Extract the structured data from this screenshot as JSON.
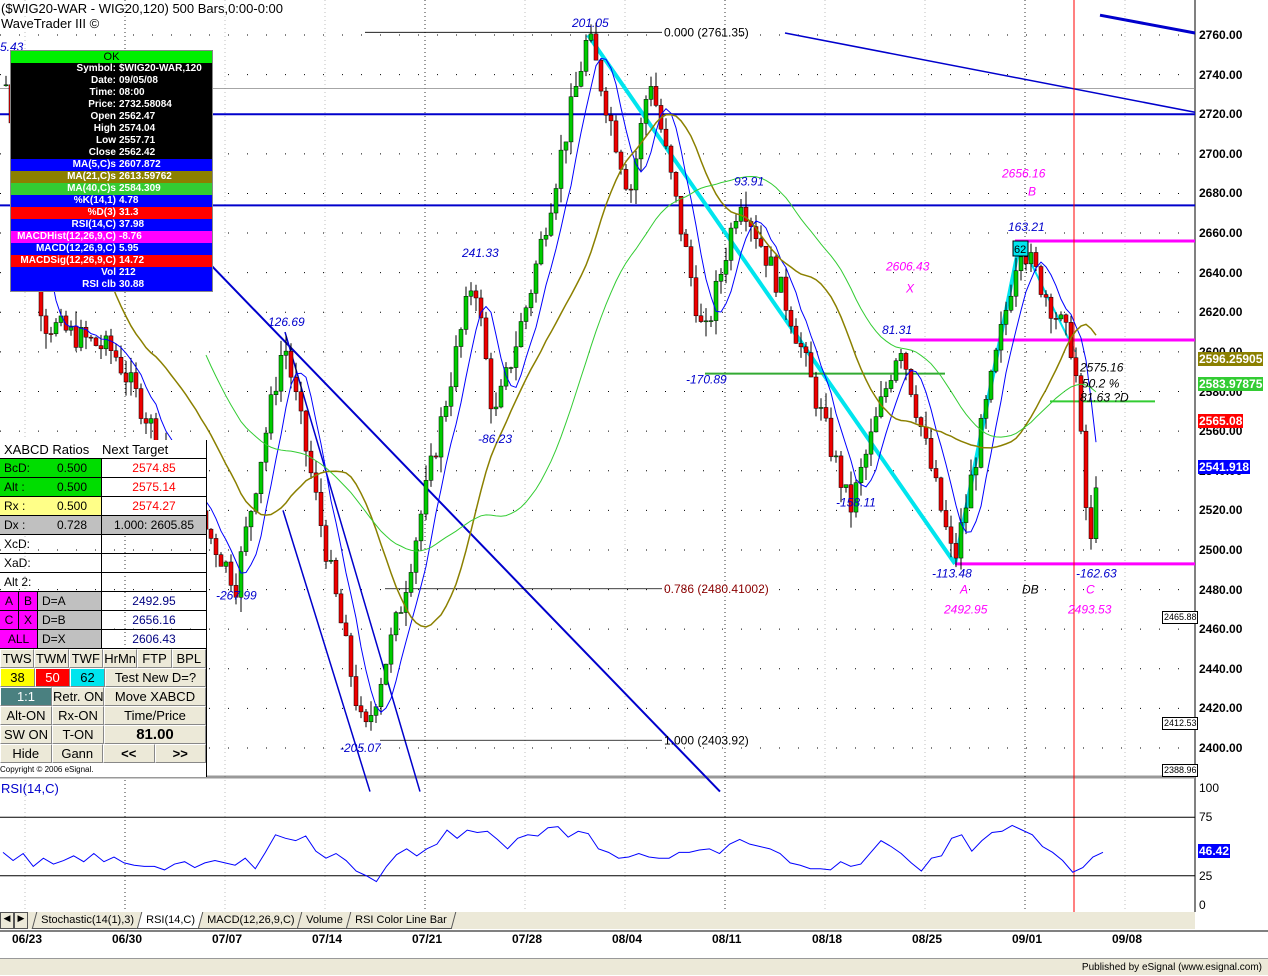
{
  "header": {
    "title": "($WIG20-WAR - WIG20,120) 500 Bars,0:00-0:00",
    "subtitle": "WaveTrader III ©",
    "corner_label": "5.43"
  },
  "info": {
    "ok": "OK",
    "rows": [
      {
        "k": "Symbol:",
        "v": "$WIG20-WAR,120",
        "bg": "#000000"
      },
      {
        "k": "Date:",
        "v": "09/05/08",
        "bg": "#000000"
      },
      {
        "k": "Time:",
        "v": "08:00",
        "bg": "#000000"
      },
      {
        "k": "Price:",
        "v": "2732.58084",
        "bg": "#000000"
      },
      {
        "k": "Open",
        "v": "2562.47",
        "bg": "#000000"
      },
      {
        "k": "High",
        "v": "2574.04",
        "bg": "#000000"
      },
      {
        "k": "Low",
        "v": "2557.71",
        "bg": "#000000"
      },
      {
        "k": "Close",
        "v": "2562.42",
        "bg": "#000000"
      },
      {
        "k": "MA(5,C)s",
        "v": "2607.872",
        "bg": "#0000ff"
      },
      {
        "k": "MA(21,C)s",
        "v": "2613.59762",
        "bg": "#8b8000"
      },
      {
        "k": "MA(40,C)s",
        "v": "2584.309",
        "bg": "#33cc33"
      },
      {
        "k": "%K(14,1)",
        "v": "4.78",
        "bg": "#0000ff"
      },
      {
        "k": "%D(3)",
        "v": "31.3",
        "bg": "#ff0000"
      },
      {
        "k": "RSI(14,C)",
        "v": "37.98",
        "bg": "#0000ff"
      },
      {
        "k": "MACDHist(12,26,9,C)",
        "v": "-8.76",
        "bg": "#ff00ff"
      },
      {
        "k": "MACD(12,26,9,C)",
        "v": "5.95",
        "bg": "#0000ff"
      },
      {
        "k": "MACDSig(12,26,9,C)",
        "v": "14.72",
        "bg": "#ff0000"
      },
      {
        "k": "Vol",
        "v": "212",
        "bg": "#0000ff"
      },
      {
        "k": "RSI clb",
        "v": "30.88",
        "bg": "#0000ff"
      }
    ]
  },
  "xabcd": {
    "header": "XABCD Ratios",
    "header2": "Next Target",
    "ratios": [
      {
        "k": "BcD:",
        "r": "0.500",
        "v": "2574.85",
        "bg": "#00dd00"
      },
      {
        "k": "Alt  :",
        "r": "0.500",
        "v": "2575.14",
        "bg": "#00dd00"
      },
      {
        "k": "Rx   :",
        "r": "0.500",
        "v": "2574.27",
        "bg": "#ffff88"
      },
      {
        "k": "Dx   :",
        "r": "0.728",
        "v": "1.000: 2605.85",
        "bg": "#c0c0c0"
      }
    ],
    "empty": [
      "XcD:",
      "XaD:",
      "Alt 2:"
    ],
    "d_rows": [
      {
        "a": "A",
        "b": "B",
        "k": "D=A",
        "v": "2492.95"
      },
      {
        "a": "C",
        "b": "X",
        "k": "D=B",
        "v": "2656.16"
      },
      {
        "a": "ALL",
        "b": "",
        "k": "D=X",
        "v": "2606.43"
      }
    ],
    "buttons1": [
      "TWS",
      "TWM",
      "TWF",
      "HrMn",
      "FTP",
      "BPL"
    ],
    "fib": [
      "38",
      "50",
      "62"
    ],
    "test": "Test New D=?",
    "b3": [
      "1:1",
      "Retr. ON",
      "Move XABCD"
    ],
    "b4": [
      "Alt-ON",
      "Rx-ON",
      "Time/Price"
    ],
    "b5": [
      "SW ON",
      "T-ON",
      "81.00"
    ],
    "b6": [
      "Hide",
      "Gann",
      "<<",
      ">>"
    ],
    "copyright": "Copyright © 2006 eSignal."
  },
  "chart_data": {
    "type": "candlestick",
    "ylim": [
      2385,
      2770
    ],
    "yticks": [
      "2760.00",
      "2740.00",
      "2720.00",
      "2700.00",
      "2680.00",
      "2660.00",
      "2640.00",
      "2620.00",
      "2600.00",
      "2580.00",
      "2560.00",
      "2540.00",
      "2520.00",
      "2500.00",
      "2480.00",
      "2460.00",
      "2440.00",
      "2420.00",
      "2400.00"
    ],
    "xticks": [
      "06/23",
      "06/30",
      "07/07",
      "07/14",
      "07/21",
      "07/28",
      "08/04",
      "08/11",
      "08/18",
      "08/25",
      "09/01",
      "09/08"
    ],
    "pivots": [
      [
        -1.2,
        2735
      ],
      [
        0.7,
        2615
      ],
      [
        4.2,
        2600
      ],
      [
        7.2,
        2540
      ],
      [
        10.3,
        2483
      ],
      [
        12.7,
        2606
      ],
      [
        16.7,
        2405
      ],
      [
        18.5,
        2470
      ],
      [
        22.2,
        2640
      ],
      [
        23.2,
        2565
      ],
      [
        25,
        2630
      ],
      [
        27.9,
        2760
      ],
      [
        30,
        2680
      ],
      [
        31,
        2740
      ],
      [
        33.7,
        2605
      ],
      [
        35.5,
        2680
      ],
      [
        38,
        2620
      ],
      [
        41,
        2520
      ],
      [
        43.5,
        2606
      ],
      [
        46.2,
        2493
      ],
      [
        49.5,
        2656
      ],
      [
        52.2,
        2600
      ],
      [
        53,
        2495
      ],
      [
        53.5,
        2565
      ]
    ],
    "price_tags": [
      {
        "v": "2596.25905",
        "c": "#8b8000",
        "p": 2596.26
      },
      {
        "v": "2583.97875",
        "c": "#33cc33",
        "p": 2583.98
      },
      {
        "v": "2565.08",
        "c": "#ff0000",
        "p": 2565.08
      },
      {
        "v": "2541.918",
        "c": "#0000ff",
        "p": 2541.92
      }
    ],
    "side_boxes": [
      {
        "v": "2465.88",
        "p": 2465.9
      },
      {
        "v": "2412.53",
        "p": 2412.5
      },
      {
        "v": "2388.96",
        "p": 2389
      }
    ],
    "annotations": [
      {
        "t": "201.05",
        "p": 2764,
        "d": 27.1,
        "c": "#0000cc"
      },
      {
        "t": "241.33",
        "p": 2648,
        "d": 21.6,
        "c": "#0000cc"
      },
      {
        "t": "126.69",
        "p": 2613,
        "d": 11.9,
        "c": "#0000cc"
      },
      {
        "t": "-86.23",
        "p": 2554,
        "d": 22.4,
        "c": "#0000cc"
      },
      {
        "t": "-267.99",
        "p": 2475,
        "d": 9.3,
        "c": "#0000cc"
      },
      {
        "t": "-205.07",
        "p": 2398,
        "d": 15.5,
        "c": "#0000cc"
      },
      {
        "t": "93.91",
        "p": 2684,
        "d": 35.2,
        "c": "#0000cc"
      },
      {
        "t": "-170.89",
        "p": 2584,
        "d": 32.8,
        "c": "#0000cc"
      },
      {
        "t": "-158.11",
        "p": 2522,
        "d": 40.3,
        "c": "#0000cc"
      },
      {
        "t": "81.31",
        "p": 2609,
        "d": 42.6,
        "c": "#0000cc"
      },
      {
        "t": "-113.48",
        "p": 2486,
        "d": 45.1,
        "c": "#0000cc"
      },
      {
        "t": "163.21",
        "p": 2661,
        "d": 48.9,
        "c": "#0000cc"
      },
      {
        "t": "-162.63",
        "p": 2486,
        "d": 52.3,
        "c": "#0000cc"
      },
      {
        "t": "2656.16",
        "p": 2688,
        "d": 48.6,
        "c": "#ff00ff"
      },
      {
        "t": "B",
        "p": 2679,
        "d": 49.9,
        "c": "#ff00ff"
      },
      {
        "t": "2606.43",
        "p": 2641,
        "d": 42.8,
        "c": "#ff00ff"
      },
      {
        "t": "X",
        "p": 2630,
        "d": 43.8,
        "c": "#ff00ff"
      },
      {
        "t": "A",
        "p": 2478,
        "d": 46.5,
        "c": "#ff00ff"
      },
      {
        "t": "2492.95",
        "p": 2468,
        "d": 45.7,
        "c": "#ff00ff"
      },
      {
        "t": "DB",
        "p": 2478,
        "d": 49.6,
        "c": "#000000"
      },
      {
        "t": "C",
        "p": 2478,
        "d": 52.8,
        "c": "#ff00ff"
      },
      {
        "t": "2493.53",
        "p": 2468,
        "d": 51.9,
        "c": "#ff00ff"
      },
      {
        "t": "2575.16",
        "p": 2590,
        "d": 52.5,
        "c": "#000000"
      },
      {
        "t": "50.2 %",
        "p": 2582,
        "d": 52.6,
        "c": "#000000"
      },
      {
        "t": "81.63 ?D",
        "p": 2575,
        "d": 52.5,
        "c": "#000000"
      }
    ],
    "fib_labels": [
      {
        "t": "0.000 (2761.35)",
        "p": 2761.35
      },
      {
        "t": "0.786 (2480.41002)",
        "p": 2480.41
      },
      {
        "t": "1.000 (2403.92)",
        "p": 2403.92
      }
    ],
    "rsi": {
      "label": "RSI(14,C)",
      "ticks": [
        "100",
        "75",
        "25",
        "0"
      ],
      "current": "46.42",
      "values": [
        45,
        38,
        44,
        33,
        40,
        35,
        38,
        42,
        37,
        44,
        37,
        41,
        36,
        34,
        33,
        33,
        30,
        35,
        37,
        32,
        36,
        38,
        36,
        34,
        40,
        31,
        45,
        60,
        57,
        55,
        59,
        46,
        40,
        44,
        38,
        29,
        25,
        20,
        33,
        43,
        48,
        42,
        48,
        52,
        64,
        57,
        64,
        62,
        63,
        56,
        48,
        57,
        60,
        59,
        66,
        67,
        58,
        63,
        61,
        48,
        45,
        40,
        41,
        44,
        41,
        40,
        40,
        45,
        45,
        47,
        48,
        44,
        52,
        56,
        52,
        50,
        48,
        44,
        36,
        34,
        31,
        31,
        30,
        37,
        33,
        35,
        45,
        55,
        50,
        44,
        36,
        29,
        40,
        42,
        57,
        60,
        46,
        55,
        62,
        63,
        68,
        64,
        60,
        50,
        45,
        38,
        28,
        32,
        41,
        45
      ]
    },
    "tabs": [
      "Stochastic(14(1),3)",
      "RSI(14,C)",
      "MACD(12,26,9,C)",
      "Volume",
      "RSI Color Line Bar"
    ]
  },
  "footer": "Published by eSignal (www.esignal.com)"
}
